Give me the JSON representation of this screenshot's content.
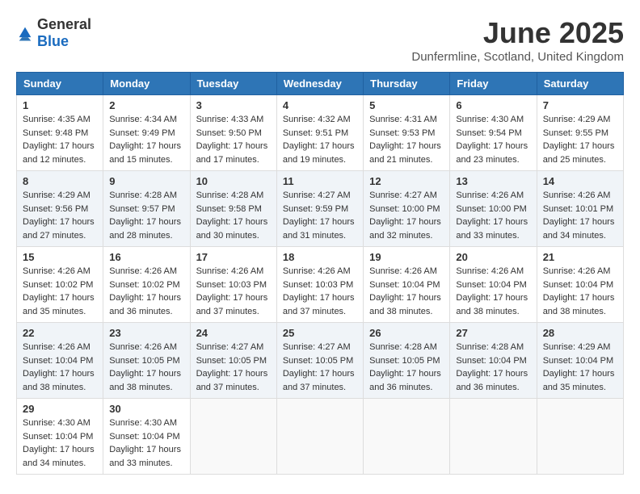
{
  "header": {
    "logo_general": "General",
    "logo_blue": "Blue",
    "month_title": "June 2025",
    "location": "Dunfermline, Scotland, United Kingdom"
  },
  "days_of_week": [
    "Sunday",
    "Monday",
    "Tuesday",
    "Wednesday",
    "Thursday",
    "Friday",
    "Saturday"
  ],
  "weeks": [
    [
      {
        "day": "1",
        "sunrise": "4:35 AM",
        "sunset": "9:48 PM",
        "daylight": "17 hours and 12 minutes."
      },
      {
        "day": "2",
        "sunrise": "4:34 AM",
        "sunset": "9:49 PM",
        "daylight": "17 hours and 15 minutes."
      },
      {
        "day": "3",
        "sunrise": "4:33 AM",
        "sunset": "9:50 PM",
        "daylight": "17 hours and 17 minutes."
      },
      {
        "day": "4",
        "sunrise": "4:32 AM",
        "sunset": "9:51 PM",
        "daylight": "17 hours and 19 minutes."
      },
      {
        "day": "5",
        "sunrise": "4:31 AM",
        "sunset": "9:53 PM",
        "daylight": "17 hours and 21 minutes."
      },
      {
        "day": "6",
        "sunrise": "4:30 AM",
        "sunset": "9:54 PM",
        "daylight": "17 hours and 23 minutes."
      },
      {
        "day": "7",
        "sunrise": "4:29 AM",
        "sunset": "9:55 PM",
        "daylight": "17 hours and 25 minutes."
      }
    ],
    [
      {
        "day": "8",
        "sunrise": "4:29 AM",
        "sunset": "9:56 PM",
        "daylight": "17 hours and 27 minutes."
      },
      {
        "day": "9",
        "sunrise": "4:28 AM",
        "sunset": "9:57 PM",
        "daylight": "17 hours and 28 minutes."
      },
      {
        "day": "10",
        "sunrise": "4:28 AM",
        "sunset": "9:58 PM",
        "daylight": "17 hours and 30 minutes."
      },
      {
        "day": "11",
        "sunrise": "4:27 AM",
        "sunset": "9:59 PM",
        "daylight": "17 hours and 31 minutes."
      },
      {
        "day": "12",
        "sunrise": "4:27 AM",
        "sunset": "10:00 PM",
        "daylight": "17 hours and 32 minutes."
      },
      {
        "day": "13",
        "sunrise": "4:26 AM",
        "sunset": "10:00 PM",
        "daylight": "17 hours and 33 minutes."
      },
      {
        "day": "14",
        "sunrise": "4:26 AM",
        "sunset": "10:01 PM",
        "daylight": "17 hours and 34 minutes."
      }
    ],
    [
      {
        "day": "15",
        "sunrise": "4:26 AM",
        "sunset": "10:02 PM",
        "daylight": "17 hours and 35 minutes."
      },
      {
        "day": "16",
        "sunrise": "4:26 AM",
        "sunset": "10:02 PM",
        "daylight": "17 hours and 36 minutes."
      },
      {
        "day": "17",
        "sunrise": "4:26 AM",
        "sunset": "10:03 PM",
        "daylight": "17 hours and 37 minutes."
      },
      {
        "day": "18",
        "sunrise": "4:26 AM",
        "sunset": "10:03 PM",
        "daylight": "17 hours and 37 minutes."
      },
      {
        "day": "19",
        "sunrise": "4:26 AM",
        "sunset": "10:04 PM",
        "daylight": "17 hours and 38 minutes."
      },
      {
        "day": "20",
        "sunrise": "4:26 AM",
        "sunset": "10:04 PM",
        "daylight": "17 hours and 38 minutes."
      },
      {
        "day": "21",
        "sunrise": "4:26 AM",
        "sunset": "10:04 PM",
        "daylight": "17 hours and 38 minutes."
      }
    ],
    [
      {
        "day": "22",
        "sunrise": "4:26 AM",
        "sunset": "10:04 PM",
        "daylight": "17 hours and 38 minutes."
      },
      {
        "day": "23",
        "sunrise": "4:26 AM",
        "sunset": "10:05 PM",
        "daylight": "17 hours and 38 minutes."
      },
      {
        "day": "24",
        "sunrise": "4:27 AM",
        "sunset": "10:05 PM",
        "daylight": "17 hours and 37 minutes."
      },
      {
        "day": "25",
        "sunrise": "4:27 AM",
        "sunset": "10:05 PM",
        "daylight": "17 hours and 37 minutes."
      },
      {
        "day": "26",
        "sunrise": "4:28 AM",
        "sunset": "10:05 PM",
        "daylight": "17 hours and 36 minutes."
      },
      {
        "day": "27",
        "sunrise": "4:28 AM",
        "sunset": "10:04 PM",
        "daylight": "17 hours and 36 minutes."
      },
      {
        "day": "28",
        "sunrise": "4:29 AM",
        "sunset": "10:04 PM",
        "daylight": "17 hours and 35 minutes."
      }
    ],
    [
      {
        "day": "29",
        "sunrise": "4:30 AM",
        "sunset": "10:04 PM",
        "daylight": "17 hours and 34 minutes."
      },
      {
        "day": "30",
        "sunrise": "4:30 AM",
        "sunset": "10:04 PM",
        "daylight": "17 hours and 33 minutes."
      },
      null,
      null,
      null,
      null,
      null
    ]
  ]
}
